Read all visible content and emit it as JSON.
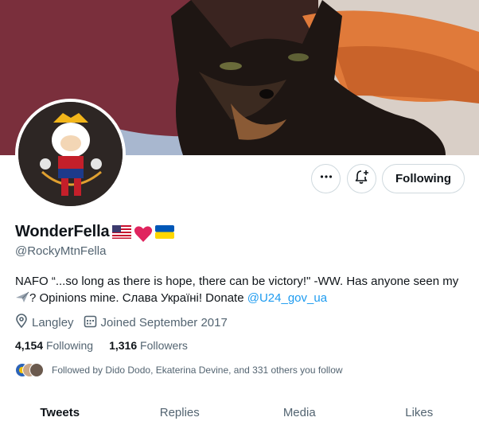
{
  "profile": {
    "display_name": "WonderFella",
    "handle": "@RockyMtnFella",
    "bio_text": "NAFO “...so long as there is hope, there can be victory!\" -WW. Has anyone seen my",
    "bio_text_2": "? Opinions mine. Слава Україні! Donate ",
    "bio_link": "@U24_gov_ua",
    "location": "Langley",
    "joined": "Joined September 2017"
  },
  "actions": {
    "following_label": "Following"
  },
  "stats": {
    "following_count": "4,154",
    "following_label": "Following",
    "followers_count": "1,316",
    "followers_label": "Followers"
  },
  "followed_by": "Followed by Dido Dodo, Ekaterina Devine, and 331 others you follow",
  "tabs": [
    {
      "label": "Tweets",
      "active": true
    },
    {
      "label": "Replies",
      "active": false
    },
    {
      "label": "Media",
      "active": false
    },
    {
      "label": "Likes",
      "active": false
    }
  ],
  "icons": {
    "more": "more-dots-icon",
    "notify": "notification-bell-plus-icon",
    "location": "location-pin-icon",
    "calendar": "calendar-icon",
    "name_emojis": [
      "us-flag-icon",
      "red-heart-icon",
      "ukraine-flag-icon"
    ],
    "bio_emoji": "airplane-icon"
  },
  "colors": {
    "link": "#1d9bf0",
    "secondary_text": "#536471",
    "primary_text": "#0f1419",
    "heart": "#e0245e"
  }
}
